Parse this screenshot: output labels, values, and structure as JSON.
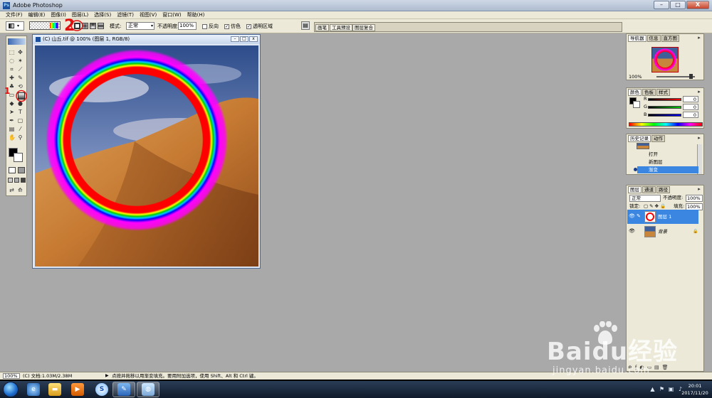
{
  "titlebar": {
    "title": "Adobe Photoshop",
    "app_icon": "Ps"
  },
  "window_controls": {
    "minimize": "–",
    "maximize": "□",
    "close": "X"
  },
  "menus": [
    "文件(F)",
    "编辑(E)",
    "图像(I)",
    "图层(L)",
    "选择(S)",
    "滤镜(T)",
    "视图(V)",
    "窗口(W)",
    "帮助(H)"
  ],
  "options": {
    "mode_label": "模式:",
    "mode_value": "正常",
    "opacity_label": "不透明度:",
    "opacity_value": "100%",
    "reverse_label": "反向",
    "dither_label": "仿色",
    "transparency_label": "透明区域",
    "dither_checked": "✓",
    "transparency_checked": "✓",
    "well_tabs": [
      "画笔",
      "工具预设",
      "图层复合"
    ]
  },
  "annotations": {
    "one": "1",
    "two": "2"
  },
  "document": {
    "title": "(C) 山丘.tif @ 100% (图层 1, RGB/8)",
    "controls": [
      "–",
      "□",
      "x"
    ]
  },
  "navigator": {
    "tabs": [
      "导航器",
      "信息",
      "直方图"
    ],
    "zoom": "100%"
  },
  "color_panel": {
    "tabs": [
      "颜色",
      "色板",
      "样式"
    ],
    "channels": [
      {
        "label": "R",
        "value": "0"
      },
      {
        "label": "G",
        "value": "0"
      },
      {
        "label": "B",
        "value": "0"
      }
    ]
  },
  "history": {
    "tabs": [
      "历史记录",
      "动作"
    ],
    "items": [
      "打开",
      "新图层",
      "渐变"
    ]
  },
  "layers": {
    "tabs": [
      "图层",
      "通道",
      "路径"
    ],
    "blend_mode": "正常",
    "opacity_label": "不透明度:",
    "opacity_value": "100%",
    "lock_label": "锁定:",
    "fill_label": "填充:",
    "fill_value": "100%",
    "rows": [
      {
        "name": "图层 1",
        "selected": true
      },
      {
        "name": "背景",
        "selected": false
      }
    ]
  },
  "status": {
    "zoom": "100%",
    "doc_info": "(C) 文档:1.03M/2.38M",
    "hint": "点按并拖移以用渐变填充。要用附加选项，使用 Shift、Alt 和 Ctrl 键。"
  },
  "taskbar": {
    "time": "20:01",
    "date": "2017/11/20",
    "icons": [
      "start-orb",
      "ie-icon",
      "explorer-icon",
      "media-player-icon",
      "sogou-icon",
      "photoshop-icon",
      "paint-icon"
    ]
  },
  "watermark": {
    "brand": "Baidu经验",
    "url": "jingyan.baidu.com"
  }
}
